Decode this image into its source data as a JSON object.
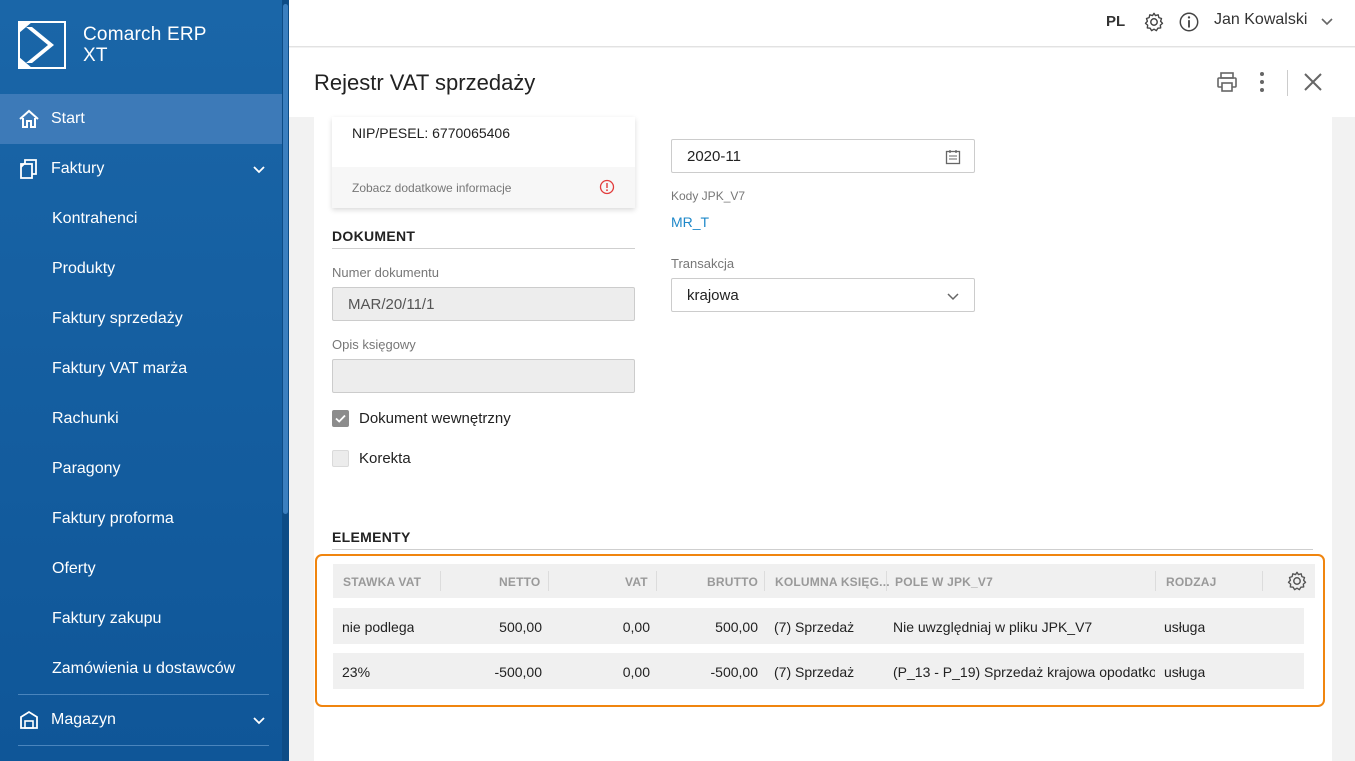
{
  "app": {
    "logo_line1": "Comarch ERP",
    "logo_line2": "XT"
  },
  "sidebar": {
    "start": "Start",
    "faktury": "Faktury",
    "sub_items": [
      "Kontrahenci",
      "Produkty",
      "Faktury sprzedaży",
      "Faktury VAT marża",
      "Rachunki",
      "Paragony",
      "Faktury proforma",
      "Oferty",
      "Faktury zakupu",
      "Zamówienia u dostawców"
    ],
    "magazyn": "Magazyn"
  },
  "topbar": {
    "lang": "PL",
    "user": "Jan Kowalski"
  },
  "header": {
    "title": "Rejestr VAT sprzedaży"
  },
  "card": {
    "nip": "NIP/PESEL: 6770065406",
    "more_info": "Zobacz dodatkowe informacje"
  },
  "dokument": {
    "section_title": "DOKUMENT",
    "numer_label": "Numer dokumentu",
    "numer_value": "MAR/20/11/1",
    "opis_label": "Opis księgowy",
    "opis_value": "",
    "wewnetrzny_label": "Dokument wewnętrzny",
    "wewnetrzny_checked": true,
    "korekta_label": "Korekta",
    "korekta_checked": false
  },
  "right": {
    "period_value": "2020-11",
    "kody_label": "Kody JPK_V7",
    "kody_value": "MR_T",
    "transakcja_label": "Transakcja",
    "transakcja_value": "krajowa"
  },
  "elementy": {
    "section_title": "ELEMENTY",
    "columns": [
      "STAWKA VAT",
      "NETTO",
      "VAT",
      "BRUTTO",
      "KOLUMNA KSIĘG...",
      "POLE W JPK_V7",
      "RODZAJ"
    ],
    "rows": [
      [
        "nie podlega",
        "500,00",
        "0,00",
        "500,00",
        "(7) Sprzedaż",
        "Nie uwzględniaj w pliku JPK_V7",
        "usługa"
      ],
      [
        "23%",
        "-500,00",
        "0,00",
        "-500,00",
        "(7) Sprzedaż",
        "(P_13 - P_19) Sprzedaż krajowa opodatko",
        "usługa"
      ]
    ]
  },
  "colors": {
    "sidebar": "#1a66a8",
    "highlight_border": "#f0850f",
    "link": "#1e88c9"
  }
}
